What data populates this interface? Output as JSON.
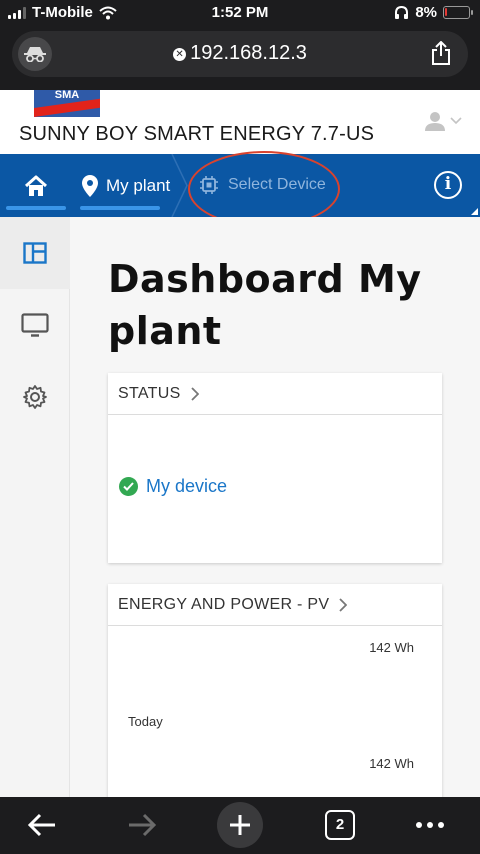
{
  "status_bar": {
    "carrier": "T-Mobile",
    "time": "1:52 PM",
    "battery_percent": "8%",
    "battery_level": 0.08,
    "battery_color": "#e53935"
  },
  "browser": {
    "url": "192.168.12.3",
    "incognito_icon": "incognito-icon",
    "share_icon": "share-icon",
    "open_tabs": "2"
  },
  "header": {
    "logo_text": "SMA",
    "device_title": "SUNNY BOY SMART ENERGY 7.7-US"
  },
  "nav": {
    "home_icon": "home-icon",
    "my_plant": "My plant",
    "select_device": "Select Device",
    "info": "i",
    "bar_color": "#0b57a4",
    "annotation_color": "#d9432e"
  },
  "sidebar": {
    "items": [
      {
        "name": "dashboard-icon",
        "active": true
      },
      {
        "name": "monitor-icon",
        "active": false
      },
      {
        "name": "settings-gear-icon",
        "active": false
      }
    ]
  },
  "main": {
    "title": "Dashboard My plant",
    "status_card": {
      "header": "STATUS",
      "device_label": "My device",
      "status_color": "#32a852"
    },
    "energy_card": {
      "header": "ENERGY AND POWER - PV",
      "value_top": "142 Wh",
      "label_today": "Today",
      "value_bottom": "142 Wh"
    }
  }
}
